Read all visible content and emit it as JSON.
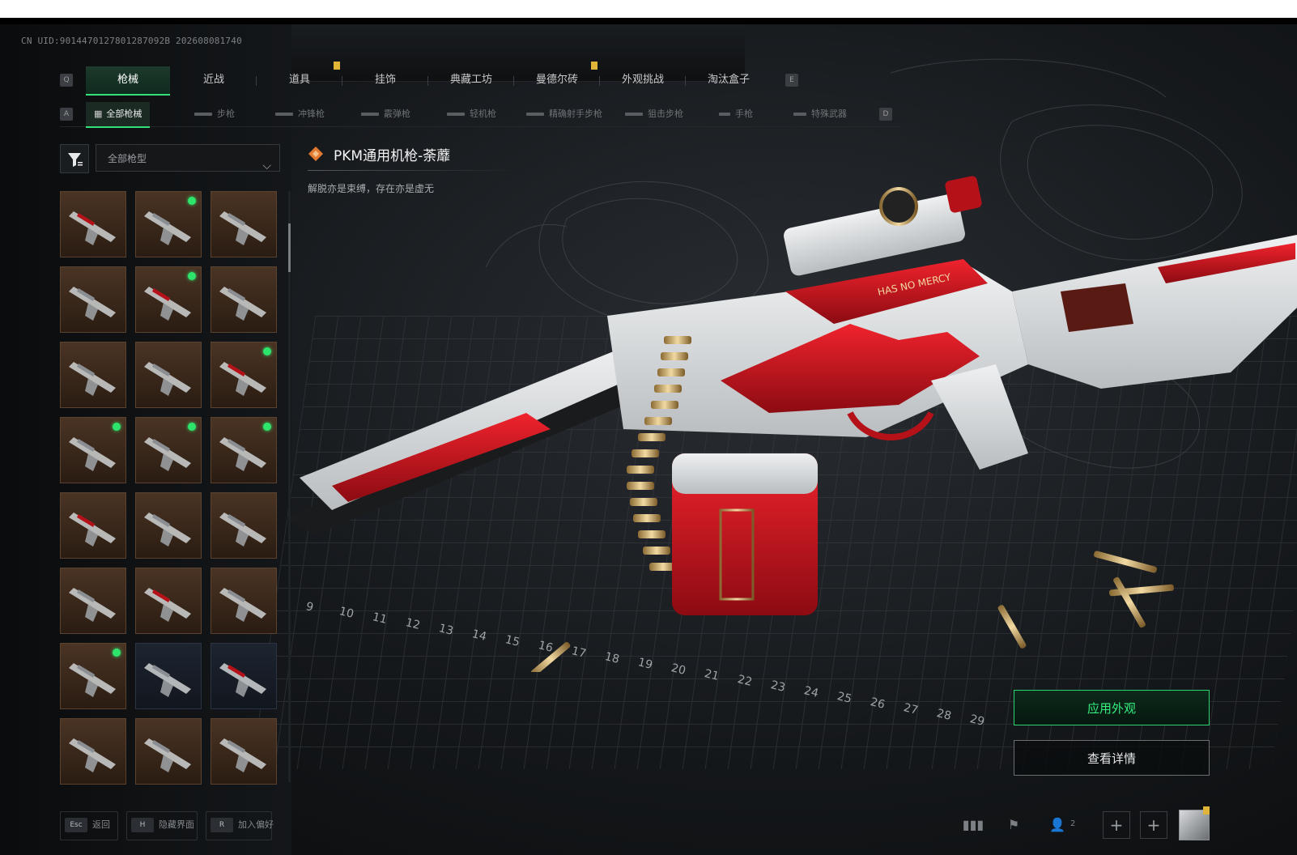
{
  "uid_text": "CN UID:9014470127801287092B 202608081740",
  "tabs_main": {
    "left_key": "Q",
    "right_key": "E",
    "items": [
      "枪械",
      "近战",
      "道具",
      "挂饰",
      "典藏工坊",
      "曼德尔砖",
      "外观挑战",
      "淘汰盒子"
    ],
    "active_index": 0,
    "marked_indices": [
      2,
      6
    ]
  },
  "tabs_sub": {
    "left_key": "A",
    "right_key": "D",
    "items": [
      "全部枪械",
      "步枪",
      "冲锋枪",
      "霰弹枪",
      "轻机枪",
      "精确射手步枪",
      "狙击步枪",
      "手枪",
      "特殊武器"
    ],
    "active_index": 0
  },
  "filter": {
    "select_value": "全部枪型",
    "filter_icon": "filter-icon",
    "chevron_icon": "chevron-down-icon"
  },
  "grid": {
    "columns": 3,
    "items": [
      {
        "rarity": "gold",
        "new": false
      },
      {
        "rarity": "gold",
        "new": true
      },
      {
        "rarity": "gold",
        "new": false
      },
      {
        "rarity": "gold",
        "new": false
      },
      {
        "rarity": "gold",
        "new": true
      },
      {
        "rarity": "gold",
        "new": false
      },
      {
        "rarity": "gold",
        "new": false
      },
      {
        "rarity": "gold",
        "new": false
      },
      {
        "rarity": "gold",
        "new": true
      },
      {
        "rarity": "gold",
        "new": true
      },
      {
        "rarity": "gold",
        "new": true
      },
      {
        "rarity": "gold",
        "new": true
      },
      {
        "rarity": "gold",
        "new": false
      },
      {
        "rarity": "gold",
        "new": false
      },
      {
        "rarity": "gold",
        "new": false
      },
      {
        "rarity": "gold",
        "new": false
      },
      {
        "rarity": "gold",
        "new": false
      },
      {
        "rarity": "gold",
        "new": false
      },
      {
        "rarity": "gold",
        "new": true
      },
      {
        "rarity": "blue",
        "new": false
      },
      {
        "rarity": "blue",
        "new": false
      },
      {
        "rarity": "gold",
        "new": false
      },
      {
        "rarity": "gold",
        "new": false
      },
      {
        "rarity": "gold",
        "new": false
      }
    ]
  },
  "item": {
    "title": "PKM通用机枪-荼蘼",
    "description": "解脱亦是束缚，存在亦是虚无",
    "rarity_icon": "diamond-rarity-icon"
  },
  "weapon_text": {
    "engraving": "HAS NO MERCY",
    "ruler_numbers": [
      "9",
      "10",
      "11",
      "12",
      "13",
      "14",
      "15",
      "16",
      "17",
      "18",
      "19",
      "20",
      "21",
      "22",
      "23",
      "24",
      "25",
      "26",
      "27",
      "28",
      "29"
    ]
  },
  "actions": {
    "apply": "应用外观",
    "details": "查看详情"
  },
  "bottom_hints": [
    {
      "key": "Esc",
      "label": "返回"
    },
    {
      "key": "H",
      "label": "隐藏界面"
    },
    {
      "key": "R",
      "label": "加入偏好"
    }
  ],
  "bottom_right": {
    "friends_count": "2",
    "icons": [
      "stats-icon",
      "flag-icon",
      "friends-icon",
      "plus-icon",
      "plus-icon",
      "avatar"
    ]
  },
  "colors": {
    "accent_green": "#33e07a",
    "mark_gold": "#e0b437",
    "weapon_red": "#d3161f",
    "weapon_white": "#e6e8ea"
  }
}
